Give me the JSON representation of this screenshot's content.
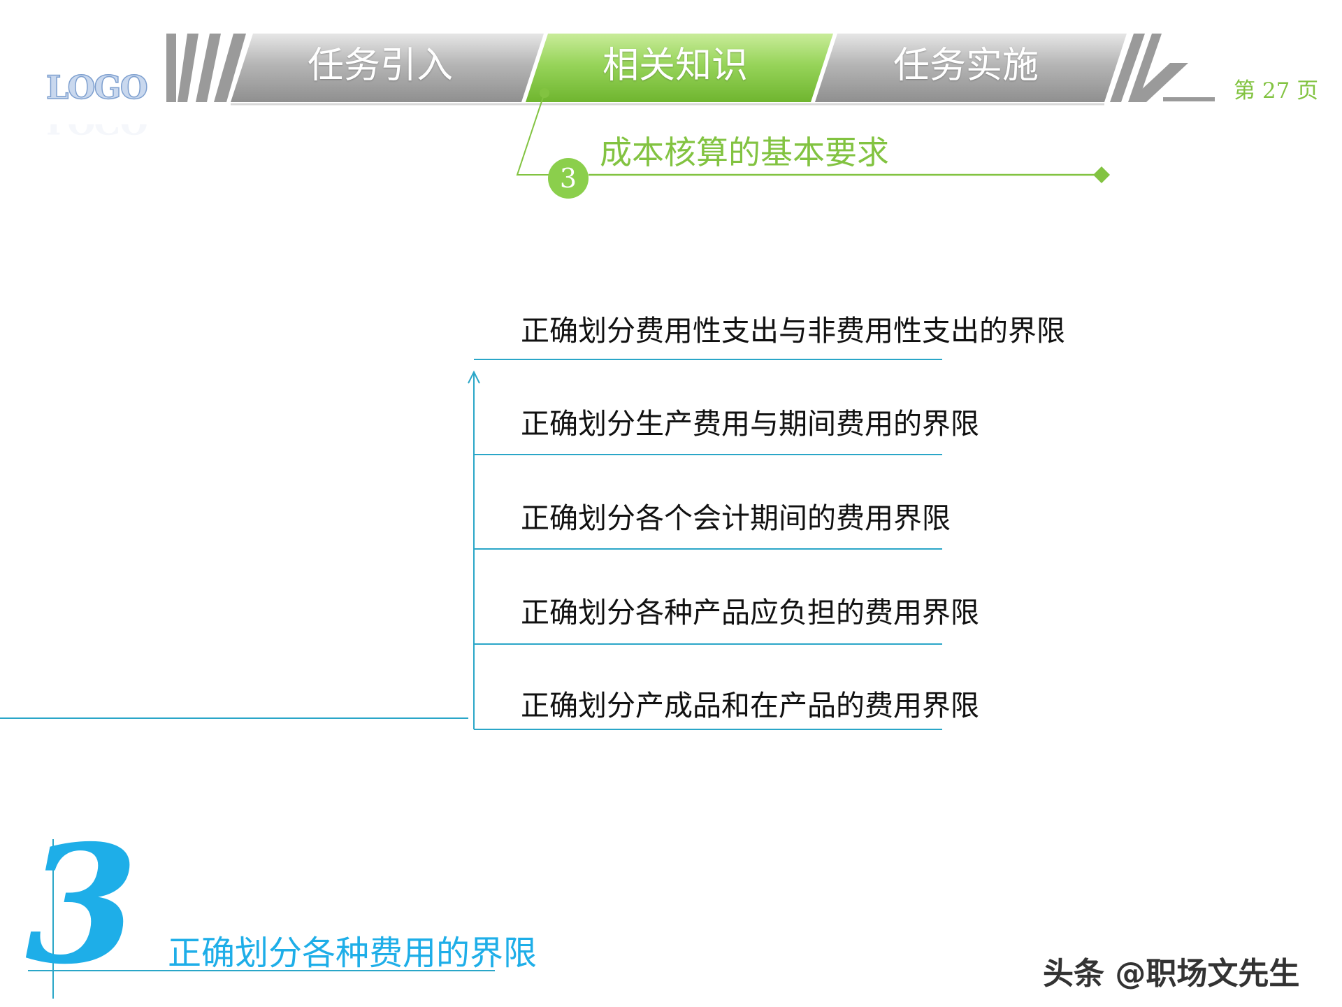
{
  "logo": {
    "text": "LOGO"
  },
  "nav": {
    "tabs": [
      {
        "label": "任务引入",
        "active": false
      },
      {
        "label": "相关知识",
        "active": true
      },
      {
        "label": "任务实施",
        "active": false
      }
    ]
  },
  "page": {
    "number_text": "第 27 页"
  },
  "section": {
    "number": "3",
    "title": "成本核算的基本要求"
  },
  "items": [
    "正确划分费用性支出与非费用性支出的界限",
    "正确划分生产费用与期间费用的界限",
    "正确划分各个会计期间的费用界限",
    "正确划分各种产品应负担的费用界限",
    "正确划分产成品和在产品的费用界限"
  ],
  "heading": {
    "number": "3",
    "title": "正确划分各种费用的界限"
  },
  "watermark": {
    "text": "头条 @职场文先生"
  },
  "colors": {
    "green": "#82c341",
    "blue": "#1eaee8",
    "gray_tab": "#a7a7a7"
  }
}
